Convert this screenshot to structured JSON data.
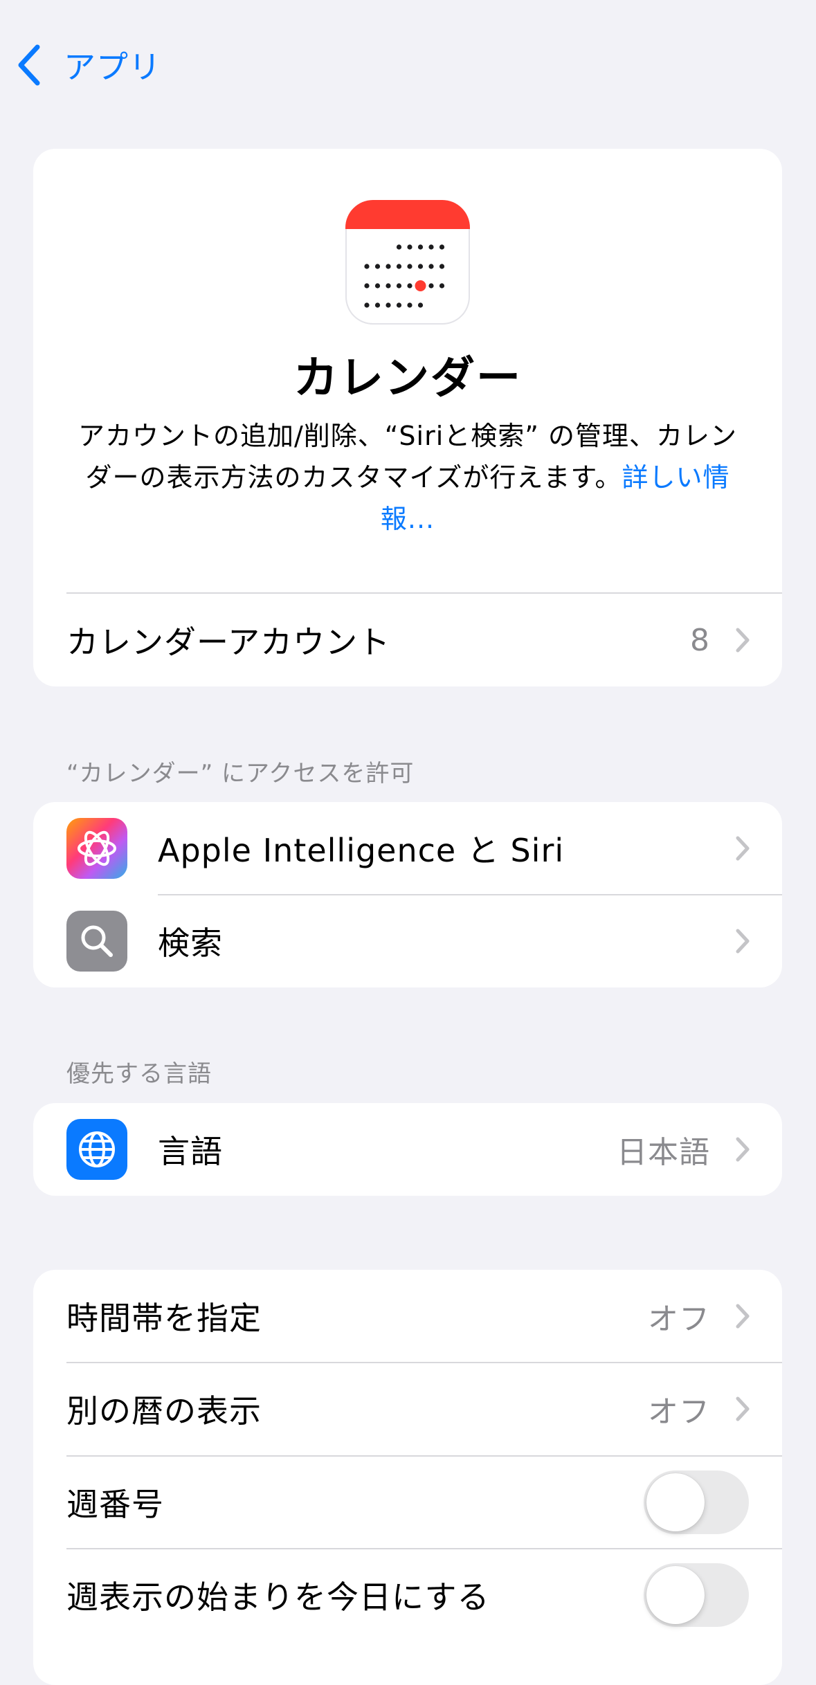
{
  "nav": {
    "back_label": "アプリ"
  },
  "hero": {
    "title": "カレンダー",
    "description": "アカウントの追加/削除、“Siriと検索” の管理、カレンダーの表示方法のカスタマイズが行えます。",
    "link": "詳しい情報..."
  },
  "accounts_row": {
    "label": "カレンダーアカウント",
    "value": "8"
  },
  "access_section": {
    "header": "“カレンダー” にアクセスを許可",
    "items": [
      {
        "label": "Apple Intelligence と Siri",
        "icon": "apple-intelligence-icon"
      },
      {
        "label": "検索",
        "icon": "search-icon"
      }
    ]
  },
  "language_section": {
    "header": "優先する言語",
    "item": {
      "label": "言語",
      "value": "日本語",
      "icon": "globe-icon"
    }
  },
  "settings": {
    "time_zone": {
      "label": "時間帯を指定",
      "value": "オフ"
    },
    "alt_calendar": {
      "label": "別の暦の表示",
      "value": "オフ"
    },
    "week_numbers": {
      "label": "週番号",
      "enabled": false
    },
    "start_today": {
      "label": "週表示の始まりを今日にする",
      "enabled": false
    }
  },
  "colors": {
    "accent": "#0a7aff",
    "calendar_red": "#ff3b30",
    "secondary_text": "#8a8a8e"
  }
}
